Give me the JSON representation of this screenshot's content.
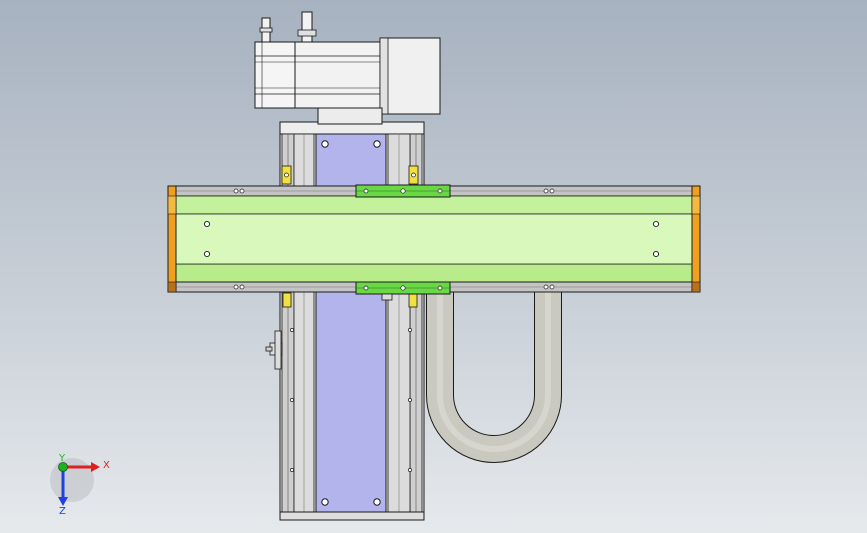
{
  "viewport": {
    "background_top": "#a7b2c0",
    "background_bottom": "#e6e9ec"
  },
  "model": {
    "colors": {
      "outline": "#1a1a1a",
      "motor_body": "#f2f2f2",
      "motor_shade": "#d8d8d8",
      "vertical_plate": "#b4b4ec",
      "horizontal_beam": "#cdf5a8",
      "beam_light": "#e3fbcc",
      "beam_dark": "#a9e07d",
      "end_cap": "#f0a020",
      "carriage_block": "#69d845",
      "rail_metal": "#c4c4c4",
      "cable_track": "#c9c9c0",
      "marker_yellow": "#f0e040"
    }
  },
  "triad": {
    "x_label": "X",
    "y_label": "Y",
    "z_label": "Z",
    "x_color": "#e02020",
    "y_color": "#20b020",
    "z_color": "#2040e0"
  }
}
